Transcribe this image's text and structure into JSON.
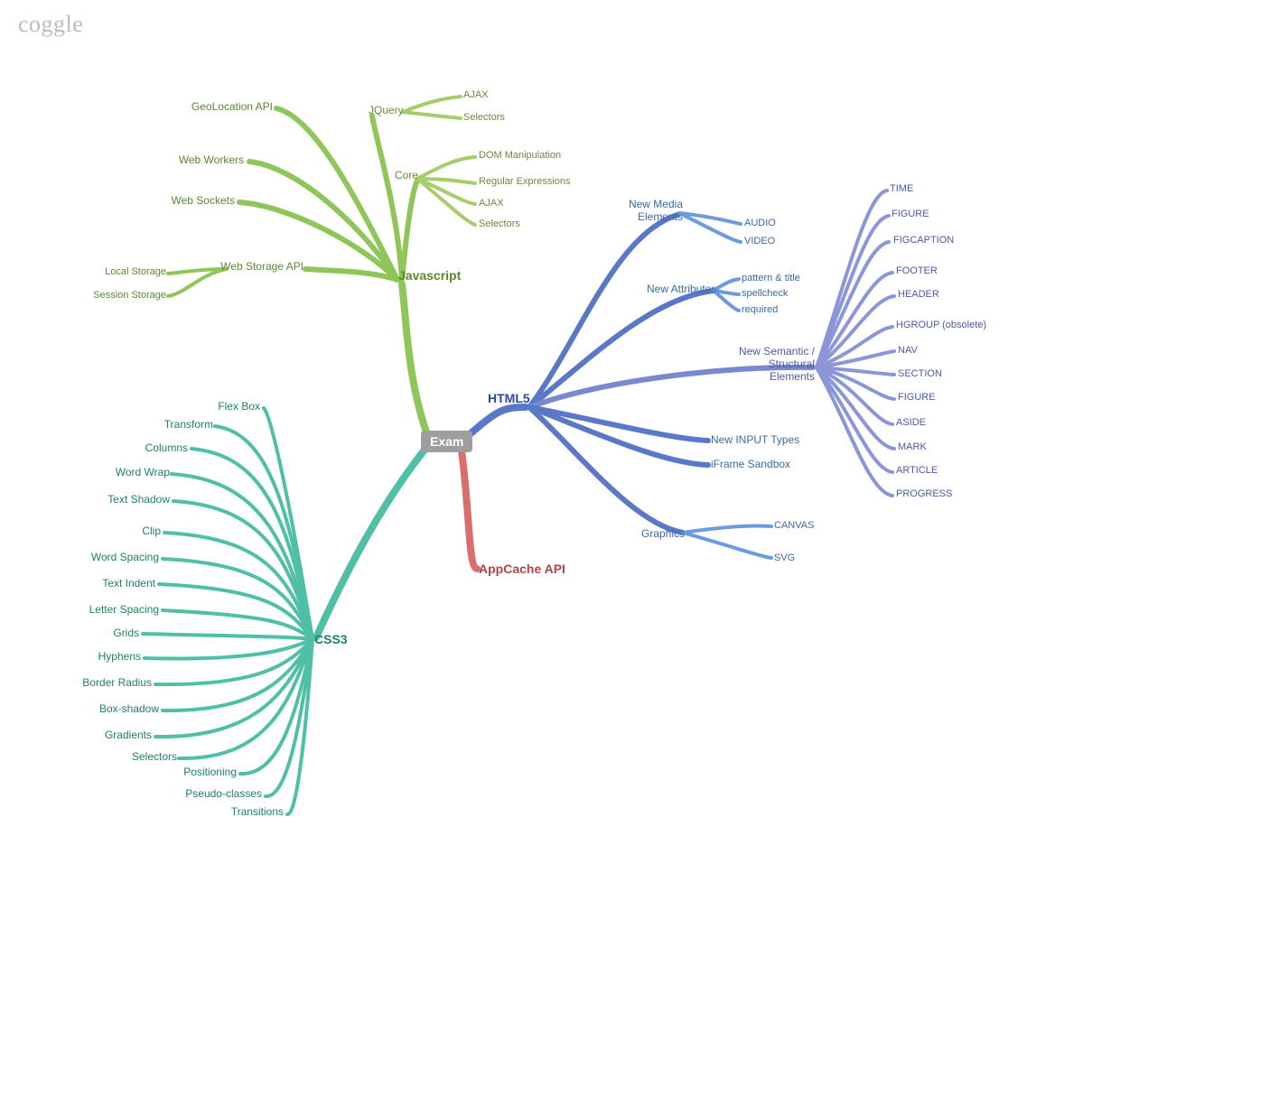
{
  "logo": "coggle",
  "root": "Exam",
  "branches": {
    "javascript": "Javascript",
    "css3": "CSS3",
    "html5": "HTML5",
    "appcache": "AppCache API"
  },
  "js": {
    "geolocation": "GeoLocation API",
    "webworkers": "Web Workers",
    "websockets": "Web Sockets",
    "webstorage": "Web Storage API",
    "localstorage": "Local Storage",
    "sessionstorage": "Session Storage",
    "jquery": "JQuery",
    "core": "Core",
    "jq_ajax": "AJAX",
    "jq_selectors": "Selectors",
    "core_dom": "DOM Manipulation",
    "core_regex": "Regular Expressions",
    "core_ajax": "AJAX",
    "core_selectors": "Selectors"
  },
  "css": {
    "flexbox": "Flex Box",
    "transform": "Transform",
    "columns": "Columns",
    "wordwrap": "Word Wrap",
    "textshadow": "Text Shadow",
    "clip": "Clip",
    "wordspacing": "Word Spacing",
    "textindent": "Text Indent",
    "letterspacing": "Letter Spacing",
    "grids": "Grids",
    "hyphens": "Hyphens",
    "borderradius": "Border Radius",
    "boxshadow": "Box-shadow",
    "gradients": "Gradients",
    "selectors": "Selectors",
    "positioning": "Positioning",
    "pseudo": "Pseudo-classes",
    "transitions": "Transitions"
  },
  "html": {
    "newmedia": "New Media\nElements",
    "audio": "AUDIO",
    "video": "VIDEO",
    "newattr": "New Attributes",
    "pattern": "pattern & title",
    "spellcheck": "spellcheck",
    "required": "required",
    "semantic": "New Semantic /\nStructural Elements",
    "newinput": "New INPUT Types",
    "iframe": "iFrame Sandbox",
    "graphics": "Graphics",
    "canvas": "CANVAS",
    "svg": "SVG",
    "sem": {
      "time": "TIME",
      "figure": "FIGURE",
      "figcaption": "FIGCAPTION",
      "footer": "FOOTER",
      "header": "HEADER",
      "hgroup": "HGROUP (obsolete)",
      "nav": "NAV",
      "section": "SECTION",
      "figure2": "FIGURE",
      "aside": "ASIDE",
      "mark": "MARK",
      "article": "ARTICLE",
      "progress": "PROGRESS"
    }
  },
  "colors": {
    "js": "#8fc65a",
    "js_dk": "#6aa83a",
    "css": "#4fc0a5",
    "css_dk": "#2aa086",
    "html": "#5a78c8",
    "html_dk": "#3a56a8",
    "semantic": "#7a88d0",
    "cache": "#d86e6e",
    "root_bg": "#9e9e9e"
  }
}
